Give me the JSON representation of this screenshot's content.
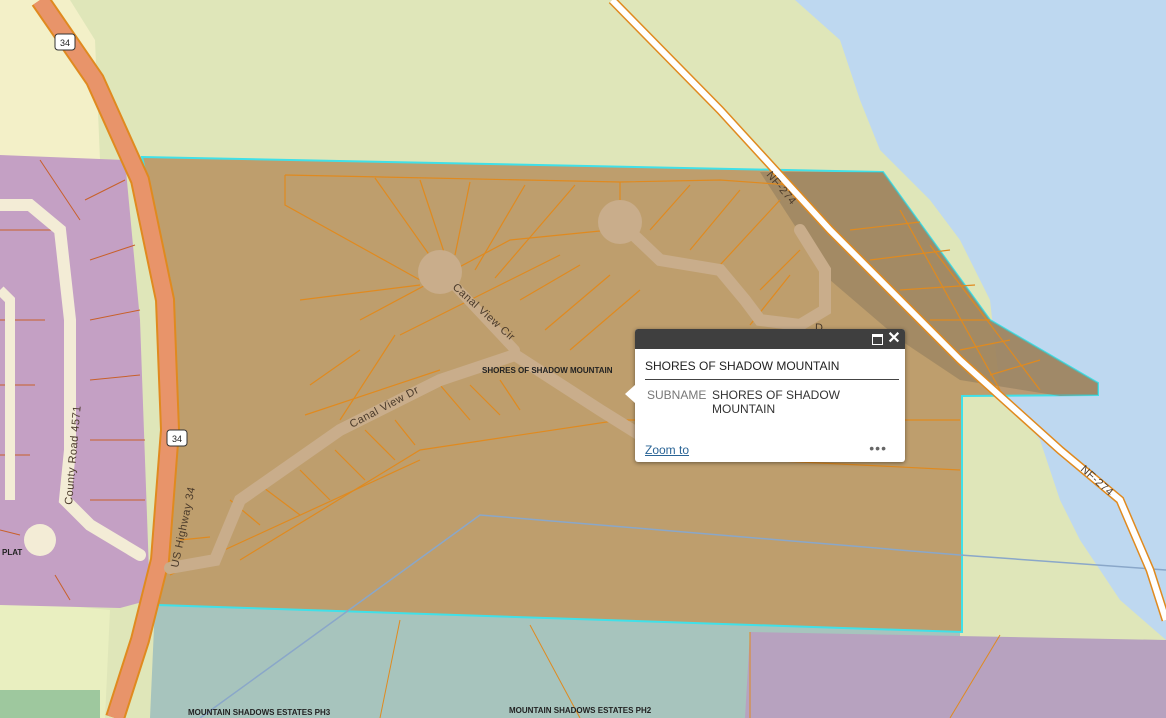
{
  "map": {
    "colors": {
      "background": "#dfe6b9",
      "water": "#bed8f0",
      "highlight_fill": "#b9905f",
      "highlight_outline": "#40e0e8",
      "parcel_line": "#e08a1f",
      "subdivision_purple": "#c4a0c4",
      "subdivision_teal": "#a7c4bd",
      "road_fill": "#c9ad8b",
      "highway_fill": "#e8946a"
    },
    "road_labels": {
      "us_highway": "US Highway 34",
      "county_road": "County Road 4571",
      "canal_view_dr": "Canal View Dr",
      "canal_view_cir": "Canal View Cir",
      "nf_274_top": "NF-274",
      "nf_274_right": "NF-274",
      "shield_top": "34",
      "shield_mid": "34",
      "partial_d": "D"
    },
    "subdivision_labels": {
      "shores": "SHORES OF SHADOW MOUNTAIN",
      "ph3": "MOUNTAIN SHADOWS ESTATES PH3",
      "ph2": "MOUNTAIN SHADOWS ESTATES PH2",
      "plat": "PLAT"
    }
  },
  "popup": {
    "title": "SHORES OF SHADOW MOUNTAIN",
    "field_label": "SUBNAME",
    "field_value": "SHORES OF SHADOW MOUNTAIN",
    "zoom_link": "Zoom to",
    "more_menu": "•••",
    "maximize_icon": "maximize-icon",
    "close_icon": "close-icon"
  }
}
